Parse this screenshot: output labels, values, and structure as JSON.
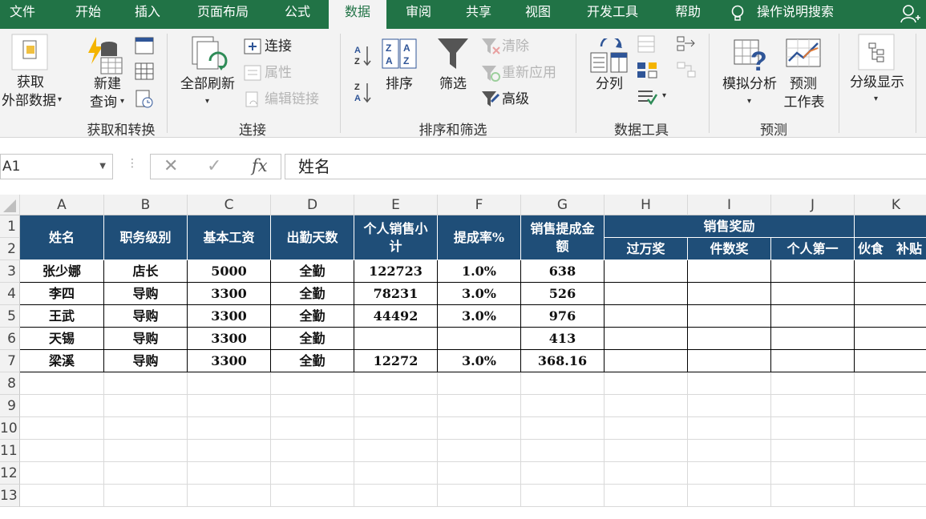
{
  "ribbon_tabs": [
    "文件",
    "开始",
    "插入",
    "页面布局",
    "公式",
    "数据",
    "审阅",
    "共享",
    "视图",
    "开发工具",
    "帮助"
  ],
  "active_tab": "数据",
  "tell_me": "操作说明搜索",
  "ribbon": {
    "get_external_1": "获取",
    "get_external_2": "外部数据",
    "new_query_1": "新建",
    "new_query_2": "查询",
    "group_get_transform": "获取和转换",
    "refresh_all": "全部刷新",
    "connections": "连接",
    "properties": "属性",
    "edit_links": "编辑链接",
    "group_connections": "连接",
    "sort": "排序",
    "filter": "筛选",
    "clear": "清除",
    "reapply": "重新应用",
    "advanced": "高级",
    "group_sort_filter": "排序和筛选",
    "text_to_columns": "分列",
    "group_data_tools": "数据工具",
    "what_if": "模拟分析",
    "forecast_1": "预测",
    "forecast_2": "工作表",
    "group_forecast": "预测",
    "outline": "分级显示"
  },
  "formula_bar": {
    "name_box": "A1",
    "fx": "fx",
    "content": "姓名"
  },
  "sheet": {
    "columns": [
      "A",
      "B",
      "C",
      "D",
      "E",
      "F",
      "G",
      "H",
      "I",
      "J",
      "K"
    ],
    "rows": [
      "1",
      "2",
      "3",
      "4",
      "5",
      "6",
      "7",
      "8",
      "9",
      "10",
      "11",
      "12",
      "13"
    ],
    "headers": {
      "name": "姓名",
      "level": "职务级别",
      "base_salary": "基本工资",
      "attendance": "出勤天数",
      "sales_1": "个人销售小",
      "sales_2": "计",
      "rate": "提成率%",
      "commission_1": "销售提成金",
      "commission_2": "额",
      "award": "销售奖励",
      "over_10k": "过万奖",
      "count_award": "件数奖",
      "top_individual": "个人第一",
      "k_sub": "伙食　补贴"
    },
    "data_rows": [
      {
        "name": "张少娜",
        "level": "店长",
        "base": "5000",
        "attendance": "全勤",
        "sales": "122723",
        "rate": "1.0%",
        "commission": "638"
      },
      {
        "name": "李四",
        "level": "导购",
        "base": "3300",
        "attendance": "全勤",
        "sales": "78231",
        "rate": "3.0%",
        "commission": "526"
      },
      {
        "name": "王武",
        "level": "导购",
        "base": "3300",
        "attendance": "全勤",
        "sales": "44492",
        "rate": "3.0%",
        "commission": "976"
      },
      {
        "name": "天锡",
        "level": "导购",
        "base": "3300",
        "attendance": "全勤",
        "sales": "",
        "rate": "",
        "commission": "413"
      },
      {
        "name": "梁溪",
        "level": "导购",
        "base": "3300",
        "attendance": "全勤",
        "sales": "12272",
        "rate": "3.0%",
        "commission": "368.16"
      }
    ]
  },
  "colors": {
    "ribbon_green": "#217346",
    "header_blue": "#1f4e78"
  }
}
